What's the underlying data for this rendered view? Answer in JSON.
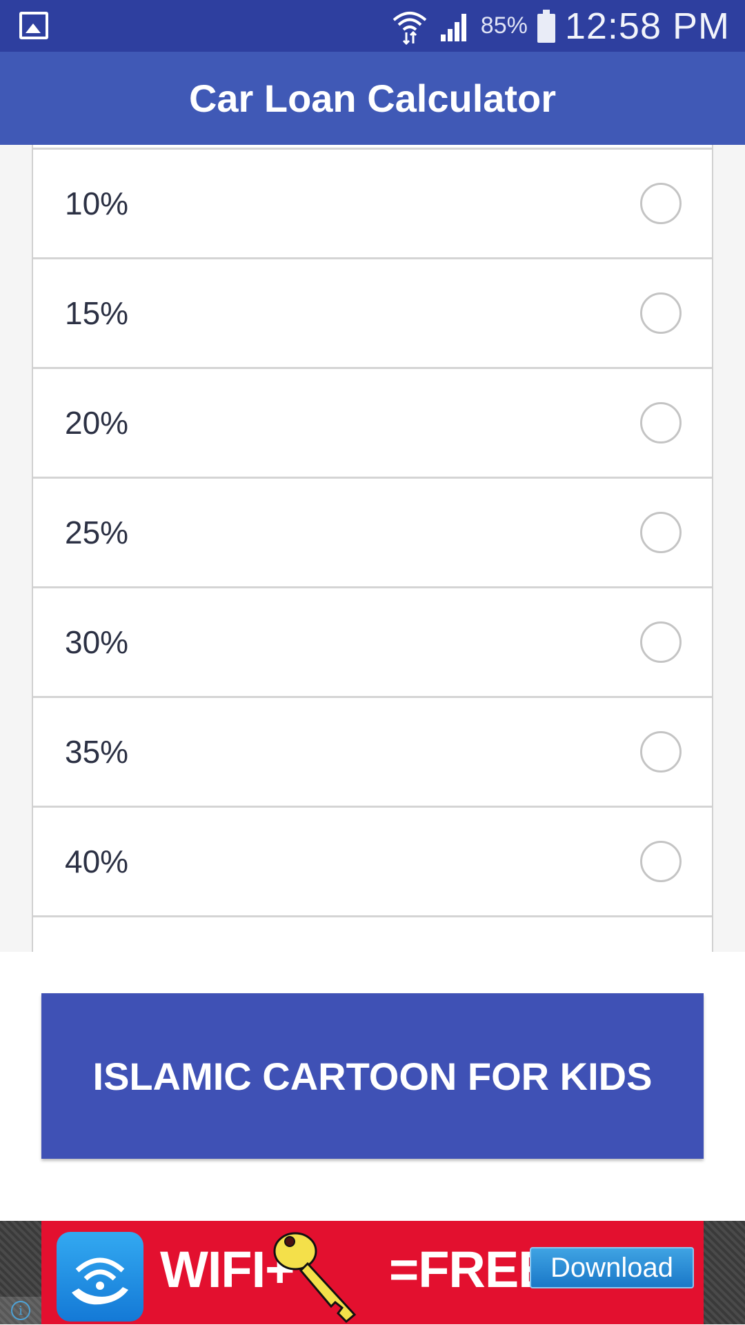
{
  "status_bar": {
    "left_icon": "gallery-icon",
    "battery_percent": "85%",
    "time": "12:58 PM",
    "background": "#2e3f9f"
  },
  "app_bar": {
    "title": "Car Loan Calculator",
    "background": "#4059b6"
  },
  "down_payment_options": [
    {
      "label": "10%",
      "selected": false
    },
    {
      "label": "15%",
      "selected": false
    },
    {
      "label": "20%",
      "selected": false
    },
    {
      "label": "25%",
      "selected": false
    },
    {
      "label": "30%",
      "selected": false
    },
    {
      "label": "35%",
      "selected": false
    },
    {
      "label": "40%",
      "selected": false
    }
  ],
  "promo_button": {
    "label": "ISLAMIC CARTOON FOR KIDS",
    "background": "#3f51b5"
  },
  "ad": {
    "left_text": "WIFI+",
    "right_text": "=FREE",
    "download_label": "Download",
    "background": "#e3102f",
    "info_icon": "info-icon"
  }
}
